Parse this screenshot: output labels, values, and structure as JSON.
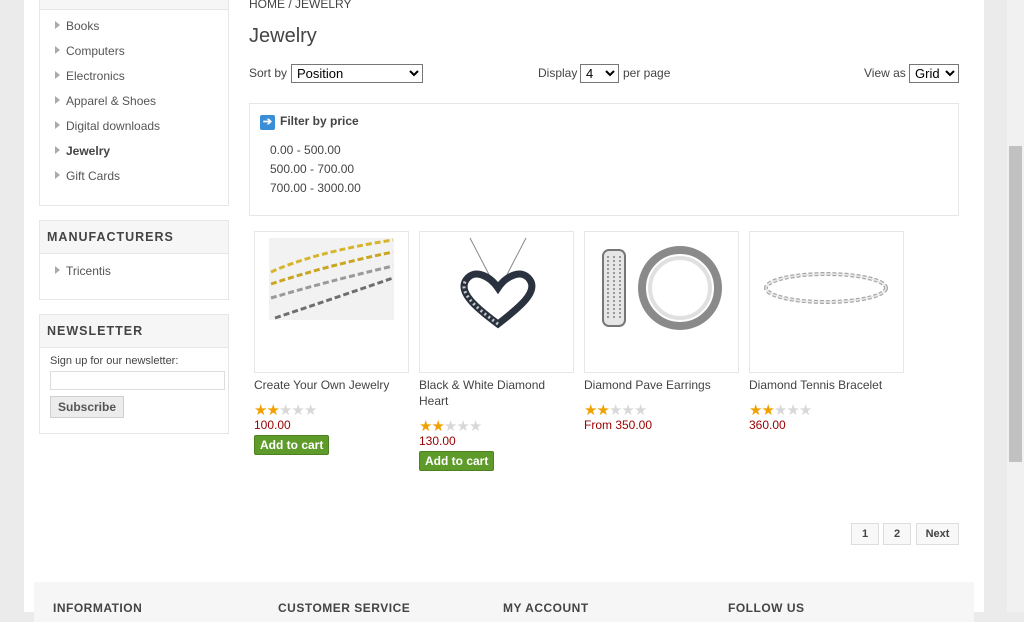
{
  "sidebar": {
    "categories": [
      {
        "label": "Books"
      },
      {
        "label": "Computers"
      },
      {
        "label": "Electronics"
      },
      {
        "label": "Apparel & Shoes"
      },
      {
        "label": "Digital downloads"
      },
      {
        "label": "Jewelry"
      },
      {
        "label": "Gift Cards"
      }
    ],
    "manufacturers_title": "MANUFACTURERS",
    "manufacturers": [
      {
        "label": "Tricentis"
      }
    ],
    "newsletter_title": "NEWSLETTER",
    "newsletter_label": "Sign up for our newsletter:",
    "newsletter_input_value": "",
    "subscribe_label": "Subscribe"
  },
  "breadcrumb": "HOME / JEWELRY",
  "page_title": "Jewelry",
  "toolbar": {
    "sort_by_label": "Sort by",
    "sort_by_value": "Position",
    "display_label": "Display",
    "display_value": "4",
    "per_page_label": "per page",
    "view_as_label": "View as",
    "view_as_value": "Grid"
  },
  "filter": {
    "title": "Filter by price",
    "ranges": [
      "0.00 - 500.00",
      "500.00 - 700.00",
      "700.00 - 3000.00"
    ]
  },
  "products": [
    {
      "name": "Create Your Own Jewelry",
      "rating": 2,
      "price": "100.00",
      "add_to_cart": "Add to cart"
    },
    {
      "name": "Black & White Diamond Heart",
      "rating": 2,
      "price": "130.00",
      "add_to_cart": "Add to cart"
    },
    {
      "name": "Diamond Pave Earrings",
      "rating": 2,
      "price": "From 350.00"
    },
    {
      "name": "Diamond Tennis Bracelet",
      "rating": 2,
      "price": "360.00"
    }
  ],
  "pager": {
    "pages": [
      "1",
      "2"
    ],
    "next": "Next"
  },
  "footer": {
    "columns": [
      "INFORMATION",
      "CUSTOMER SERVICE",
      "MY ACCOUNT",
      "FOLLOW US"
    ]
  },
  "colors": {
    "price": "#990000",
    "add_to_cart_bg": "#5f9b2a",
    "star_on": "#f0a000",
    "filter_icon": "#3a8ed8"
  },
  "icons": {
    "filter": "arrow-right-icon",
    "category_bullet": "triangle-right-icon",
    "rating": "star-icon"
  }
}
